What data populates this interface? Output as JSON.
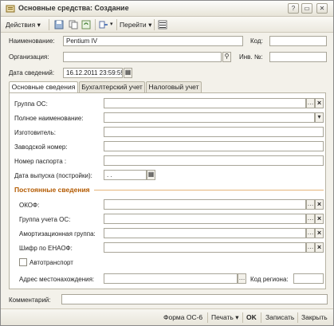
{
  "window": {
    "title": "Основные средства: Создание",
    "icon": "fixed-asset-icon",
    "controls": {
      "help": "?",
      "restore": "▭",
      "close": "✕"
    }
  },
  "toolbar": {
    "actions_label": "Действия",
    "goto_label": "Перейти",
    "icons": [
      "save-icon",
      "copy-icon",
      "refresh-icon",
      "structure-icon",
      "list-icon"
    ]
  },
  "header": {
    "name_label": "Наименование:",
    "name_value": "Pentium IV",
    "code_label": "Код:",
    "code_value": "",
    "org_label": "Организация:",
    "org_value": "",
    "inv_label": "Инв. №:",
    "inv_value": "",
    "date_label": "Дата сведений:",
    "date_value": "16.12.2011 23:59:59"
  },
  "tabs": [
    "Основные сведения",
    "Бухгалтерский учет",
    "Налоговый учет"
  ],
  "main": {
    "group_label": "Группа ОС:",
    "fullname_label": "Полное наименование:",
    "maker_label": "Изготовитель:",
    "serial_label": "Заводской номер:",
    "passport_label": "Номер паспорта :",
    "release_label": "Дата выпуска (постройки):",
    "release_value": " .  .",
    "section_title": "Постоянные сведения",
    "okof_label": "ОКОФ:",
    "acc_group_label": "Группа учета ОС:",
    "amort_group_label": "Амортизационная группа:",
    "enaof_label": "Шифр по ЕНАОФ:",
    "auto_label": "Автотранспорт",
    "auto_checked": false,
    "address_label": "Адрес местонахождения:",
    "region_label": "Код региона:"
  },
  "footer": {
    "comment_label": "Комментарий:",
    "comment_value": ""
  },
  "statusbar": {
    "form_label": "Форма ОС-6",
    "print_label": "Печать",
    "ok_label": "OK",
    "save_label": "Записать",
    "close_label": "Закрыть"
  },
  "colors": {
    "section_title": "#b35a00",
    "window_bg": "#f3f1ea"
  }
}
